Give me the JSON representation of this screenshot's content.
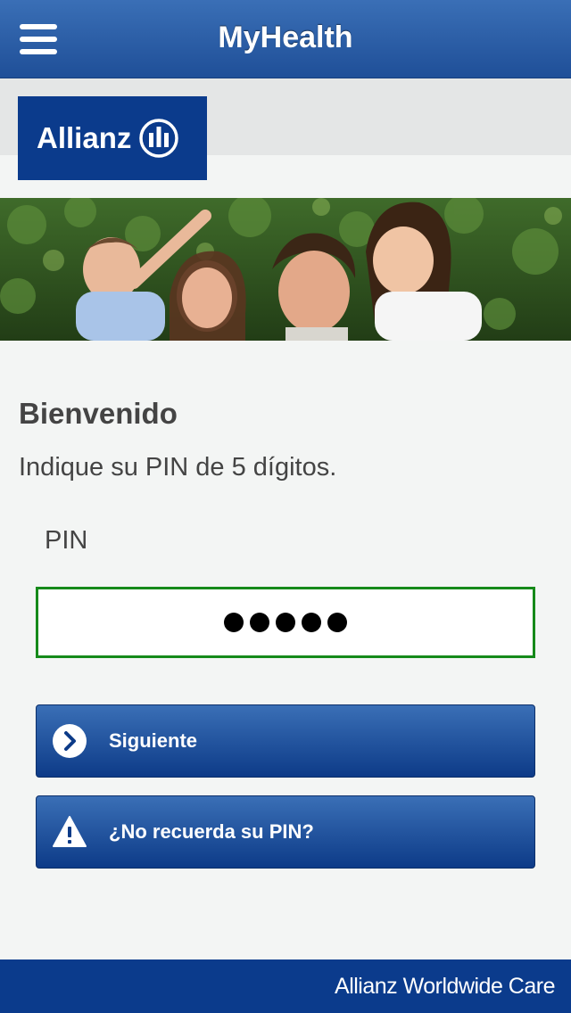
{
  "header": {
    "title": "MyHealth",
    "menu_icon": "hamburger-menu-icon"
  },
  "logo": {
    "text": "Allianz",
    "mark_icon": "allianz-eagle-mark-icon",
    "color": "#0b3b8c"
  },
  "banner": {
    "description_icon": "family-photo-banner"
  },
  "main": {
    "welcome": "Bienvenido",
    "instruction": "Indique su PIN de 5 dígitos.",
    "pin_label": "PIN",
    "pin_value_masked": "●●●●●",
    "pin_digit_count": 5
  },
  "buttons": {
    "next_label": "Siguiente",
    "next_icon": "chevron-right-circle-icon",
    "forgot_label": "¿No recuerda su PIN?",
    "forgot_icon": "warning-triangle-icon"
  },
  "footer": {
    "text": "Allianz Worldwide Care"
  },
  "colors": {
    "header_blue": "#2b5ea8",
    "brand_navy": "#0b3b8c",
    "input_border_green": "#158a1a",
    "background": "#f3f5f4",
    "text_gray": "#444444"
  }
}
